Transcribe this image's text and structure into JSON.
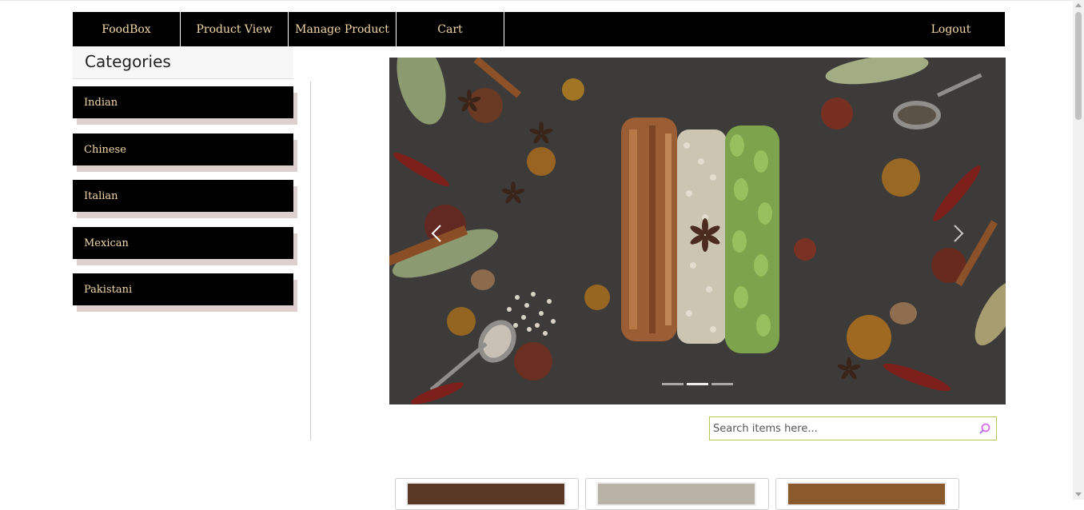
{
  "nav": {
    "brand": "FoodBox",
    "items": [
      "Product View",
      "Manage Product",
      "Cart"
    ],
    "logout": "Logout"
  },
  "sidebar": {
    "title": "Categories",
    "categories": [
      "Indian",
      "Chinese",
      "Italian",
      "Mexican",
      "Pakistani"
    ]
  },
  "carousel": {
    "slide_count": 3,
    "active_slide": 2
  },
  "search": {
    "placeholder": "Search items here..."
  },
  "colors": {
    "nav_bg": "#000000",
    "nav_text": "#f3d7a6",
    "search_border": "#b5c857",
    "search_icon": "#d36ee6"
  }
}
